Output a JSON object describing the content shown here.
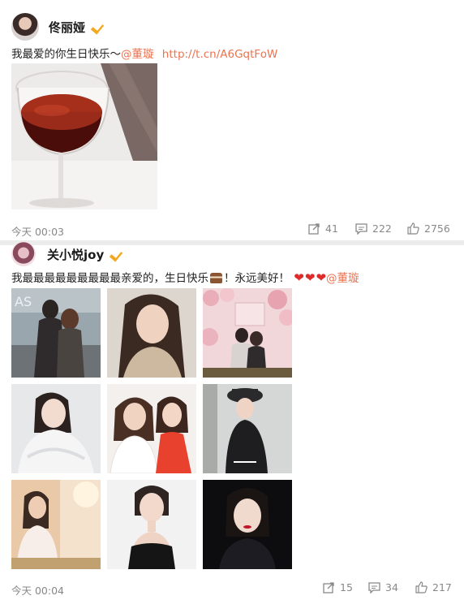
{
  "posts": [
    {
      "username": "佟丽娅",
      "text_main": "我最爱的你生日快乐～",
      "mention": "@董璇",
      "link": "http://t.cn/A6GqtFoW",
      "time": "今天 00:03",
      "reposts": "41",
      "comments": "222",
      "likes": "2756",
      "icons": [
        "avatar",
        "verified-badge",
        "repost-icon",
        "comment-icon",
        "like-icon"
      ]
    },
    {
      "username": "关小悦joy",
      "text_main": "我最最最最最最最最最亲爱的，生日快乐",
      "text_after_cake": "！永远美好！",
      "mention": "@董璇",
      "time": "今天 00:04",
      "reposts": "15",
      "comments": "34",
      "likes": "217",
      "icons": [
        "avatar",
        "verified-badge",
        "cake-emoji",
        "heart-emoji",
        "repost-icon",
        "comment-icon",
        "like-icon"
      ]
    }
  ],
  "colors": {
    "accent": "#eb7350",
    "verified": "#f4a821",
    "meta": "#888888"
  }
}
